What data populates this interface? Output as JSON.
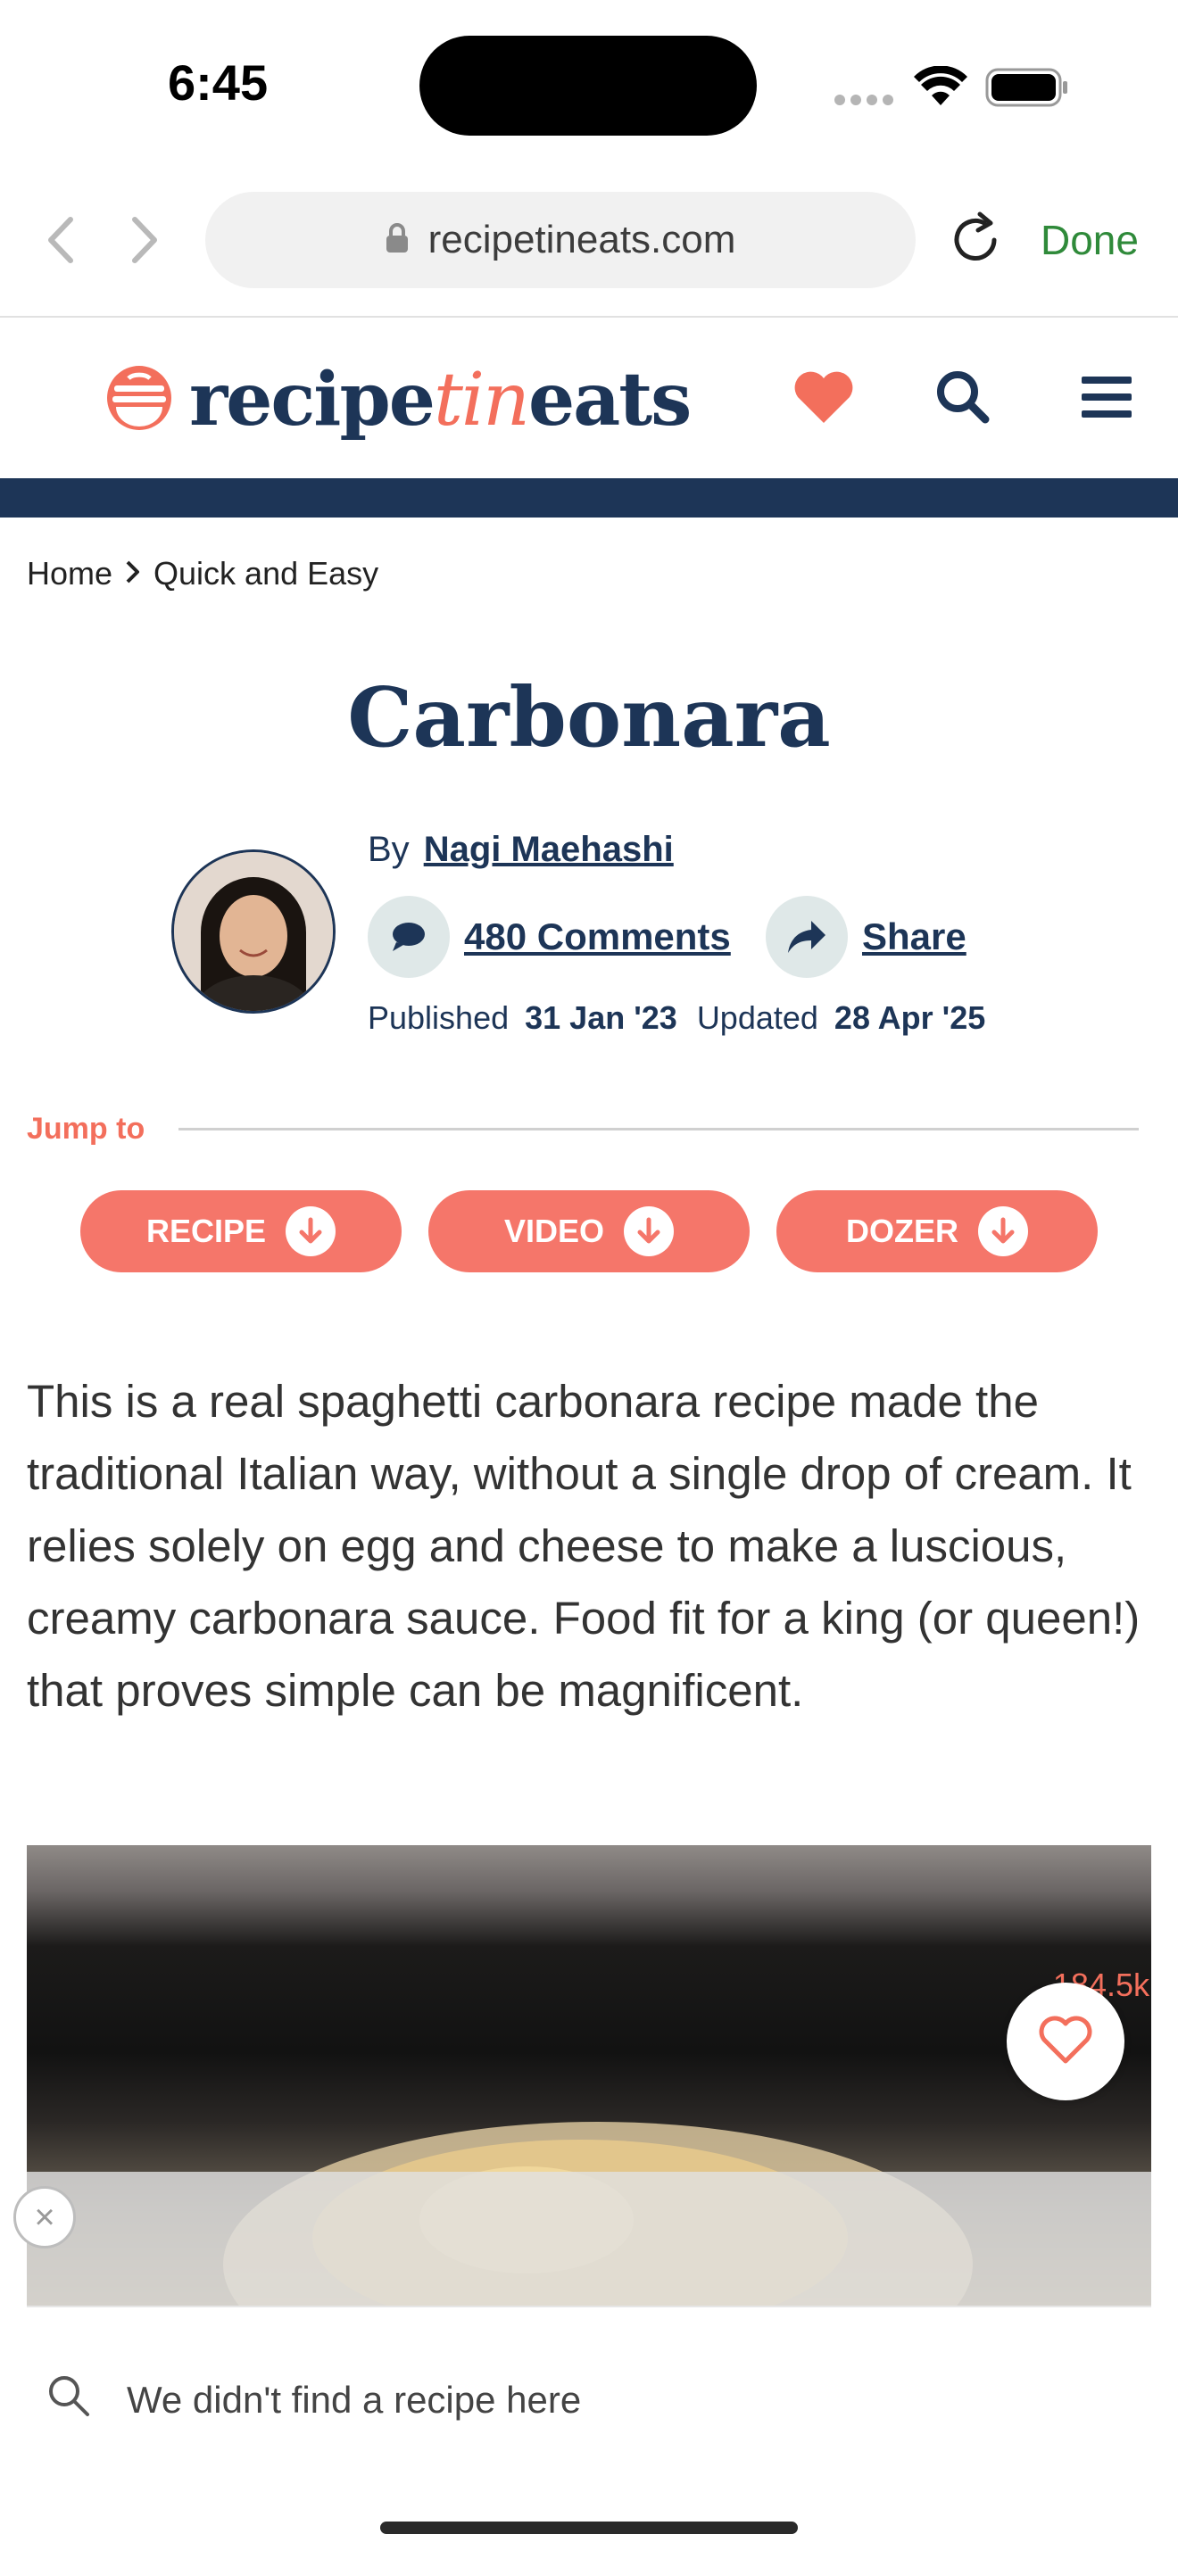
{
  "status_bar": {
    "time": "6:45"
  },
  "browser": {
    "url": "recipetineats.com",
    "done_label": "Done"
  },
  "site_header": {
    "brand_part1": "recipe",
    "brand_part2": "tin",
    "brand_part3": "eats",
    "accent_color": "#f36f5c",
    "navy_color": "#1d3557"
  },
  "breadcrumb": {
    "home": "Home",
    "current": "Quick and Easy"
  },
  "article": {
    "title": "Carbonara",
    "by_label": "By",
    "author": "Nagi Maehashi",
    "comments_label": "480 Comments",
    "share_label": "Share",
    "published_label": "Published",
    "published_date": "31 Jan '23",
    "updated_label": "Updated",
    "updated_date": "28 Apr '25",
    "intro": "This is a real spaghetti carbonara recipe made the traditional Italian way, without a single drop of cream. It relies solely on egg and cheese to make a luscious, creamy carbonara sauce. Food fit for a king (or queen!) that proves simple can be magnificent."
  },
  "jump_to": {
    "label": "Jump to",
    "buttons": [
      "RECIPE",
      "VIDEO",
      "DOZER"
    ]
  },
  "hero": {
    "like_count": "184.5k",
    "close_symbol": "×"
  },
  "bottom_bar": {
    "search_text": "We didn't find a recipe here"
  }
}
